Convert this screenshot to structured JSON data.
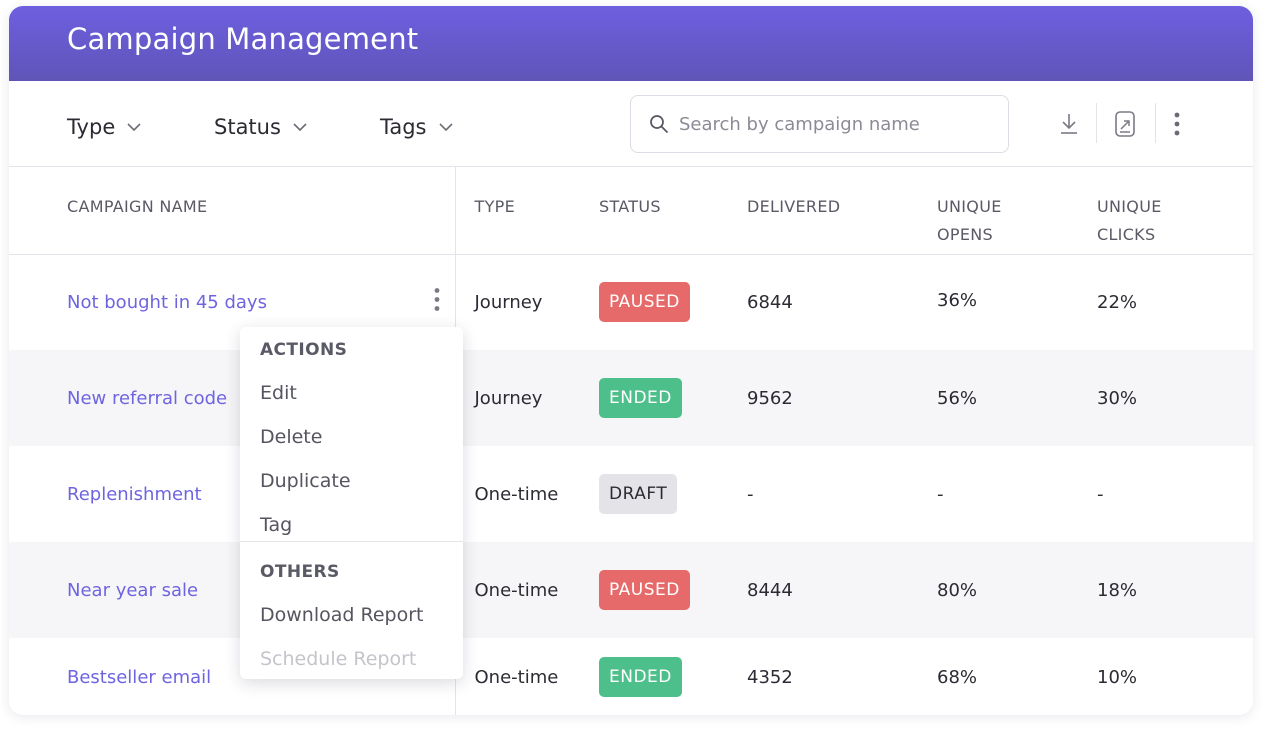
{
  "header": {
    "title": "Campaign Management"
  },
  "filters": [
    {
      "label": "Type"
    },
    {
      "label": "Status"
    },
    {
      "label": "Tags"
    }
  ],
  "search": {
    "placeholder": "Search by campaign name",
    "value": ""
  },
  "toolbar_icons": [
    "download-icon",
    "export-report-icon",
    "more-vertical-icon"
  ],
  "table": {
    "columns": [
      "CAMPAIGN NAME",
      "TYPE",
      "STATUS",
      "DELIVERED",
      "UNIQUE OPENS",
      "UNIQUE CLICKS"
    ],
    "rows": [
      {
        "name": "Not bought in 45 days",
        "type": "Journey",
        "status": "PAUSED",
        "delivered": "6844",
        "opens": "36%",
        "clicks": "22%"
      },
      {
        "name": "New referral code",
        "type": "Journey",
        "status": "ENDED",
        "delivered": "9562",
        "opens": "56%",
        "clicks": "30%"
      },
      {
        "name": "Replenishment",
        "type": "One-time",
        "status": "DRAFT",
        "delivered": "-",
        "opens": "-",
        "clicks": "-"
      },
      {
        "name": "Near year sale",
        "type": "One-time",
        "status": "PAUSED",
        "delivered": "8444",
        "opens": "80%",
        "clicks": "18%"
      },
      {
        "name": "Bestseller email",
        "type": "One-time",
        "status": "ENDED",
        "delivered": "4352",
        "opens": "68%",
        "clicks": "10%"
      }
    ]
  },
  "status_colors": {
    "PAUSED": "#e76a6a",
    "ENDED": "#4dbf8a",
    "DRAFT": "#e4e4e8"
  },
  "context_menu": {
    "actions_header": "ACTIONS",
    "actions": [
      "Edit",
      "Delete",
      "Duplicate",
      "Tag"
    ],
    "others_header": "OTHERS",
    "others": [
      {
        "label": "Download Report",
        "disabled": false
      },
      {
        "label": "Schedule Report",
        "disabled": true
      }
    ]
  },
  "colors": {
    "header_gradient_top": "#6e5fe0",
    "header_gradient_bottom": "#5f55b8",
    "link": "#6f64e0"
  }
}
